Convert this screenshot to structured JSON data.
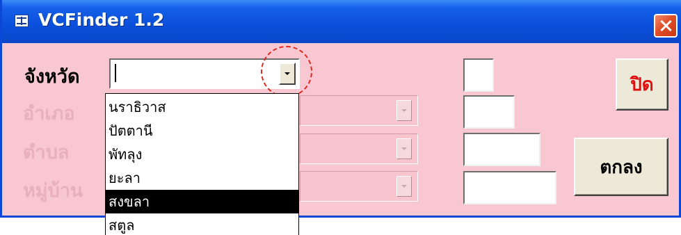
{
  "window": {
    "title": "VCFinder 1.2",
    "close_icon": "close-x-icon",
    "app_icon": "form-icon",
    "background_color": "#f9c7d2",
    "titlebar_color": "#0a4fdb"
  },
  "fields": {
    "province": {
      "label": "จังหวัด",
      "value": "",
      "state": "active"
    },
    "district": {
      "label": "อำเภอ",
      "value": "",
      "state": "disabled"
    },
    "subdistrict": {
      "label": "ตำบล",
      "value": "",
      "state": "disabled"
    },
    "village": {
      "label": "หมู่บ้าน",
      "value": "",
      "state": "disabled"
    }
  },
  "province_dropdown": {
    "options": [
      "นราธิวาส",
      "ปัตตานี",
      "พัทลุง",
      "ยะลา",
      "สงขลา",
      "สตูล"
    ],
    "selected": "สงขลา"
  },
  "code_boxes": {
    "province_code": "",
    "district_code": "",
    "subdistrict_code": "",
    "village_code": ""
  },
  "buttons": {
    "close_label": "ปิด",
    "ok_label": "ตกลง",
    "close_label_color": "#e01010"
  }
}
